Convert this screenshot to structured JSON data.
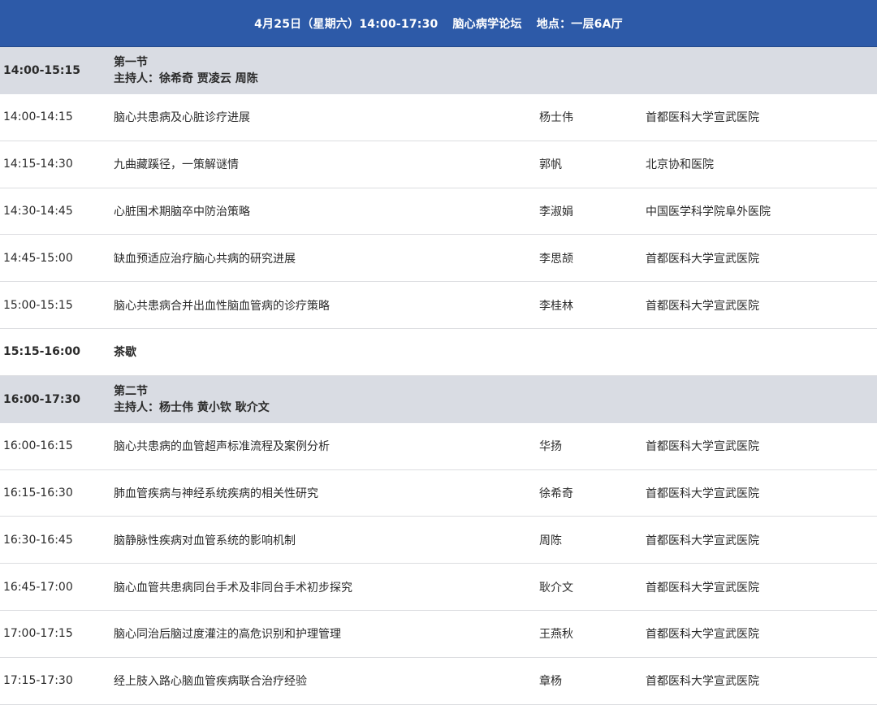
{
  "header": {
    "date": "4月25日（星期六）14:00-17:30",
    "forum": "脑心病学论坛",
    "venue": "地点：一层6A厅"
  },
  "rows": [
    {
      "type": "section",
      "time": "14:00-15:15",
      "title": "第一节",
      "hosts": "主持人：徐希奇 贾凌云 周陈"
    },
    {
      "type": "talk",
      "time": "14:00-14:15",
      "topic": "脑心共患病及心脏诊疗进展",
      "speaker": "杨士伟",
      "org": "首都医科大学宣武医院"
    },
    {
      "type": "talk",
      "time": "14:15-14:30",
      "topic": "九曲藏蹊径，一策解谜情",
      "speaker": "郭帆",
      "org": "北京协和医院"
    },
    {
      "type": "talk",
      "time": "14:30-14:45",
      "topic": "心脏围术期脑卒中防治策略",
      "speaker": "李淑娟",
      "org": "中国医学科学院阜外医院"
    },
    {
      "type": "talk",
      "time": "14:45-15:00",
      "topic": "缺血预适应治疗脑心共病的研究进展",
      "speaker": "李思颉",
      "org": "首都医科大学宣武医院"
    },
    {
      "type": "talk",
      "time": "15:00-15:15",
      "topic": "脑心共患病合并出血性脑血管病的诊疗策略",
      "speaker": "李桂林",
      "org": "首都医科大学宣武医院"
    },
    {
      "type": "break",
      "time": "15:15-16:00",
      "topic": "茶歇"
    },
    {
      "type": "section",
      "time": "16:00-17:30",
      "title": "第二节",
      "hosts": "主持人：杨士伟 黄小钦 耿介文"
    },
    {
      "type": "talk",
      "time": "16:00-16:15",
      "topic": "脑心共患病的血管超声标准流程及案例分析",
      "speaker": "华扬",
      "org": "首都医科大学宣武医院"
    },
    {
      "type": "talk",
      "time": "16:15-16:30",
      "topic": "肺血管疾病与神经系统疾病的相关性研究",
      "speaker": "徐希奇",
      "org": "首都医科大学宣武医院"
    },
    {
      "type": "talk",
      "time": "16:30-16:45",
      "topic": "脑静脉性疾病对血管系统的影响机制",
      "speaker": "周陈",
      "org": "首都医科大学宣武医院"
    },
    {
      "type": "talk",
      "time": "16:45-17:00",
      "topic": "脑心血管共患病同台手术及非同台手术初步探究",
      "speaker": "耿介文",
      "org": "首都医科大学宣武医院"
    },
    {
      "type": "talk",
      "time": "17:00-17:15",
      "topic": "脑心同治后脑过度灌注的高危识别和护理管理",
      "speaker": "王燕秋",
      "org": "首都医科大学宣武医院"
    },
    {
      "type": "talk",
      "time": "17:15-17:30",
      "topic": "经上肢入路心脑血管疾病联合治疗经验",
      "speaker": "章杨",
      "org": "首都医科大学宣武医院"
    }
  ]
}
